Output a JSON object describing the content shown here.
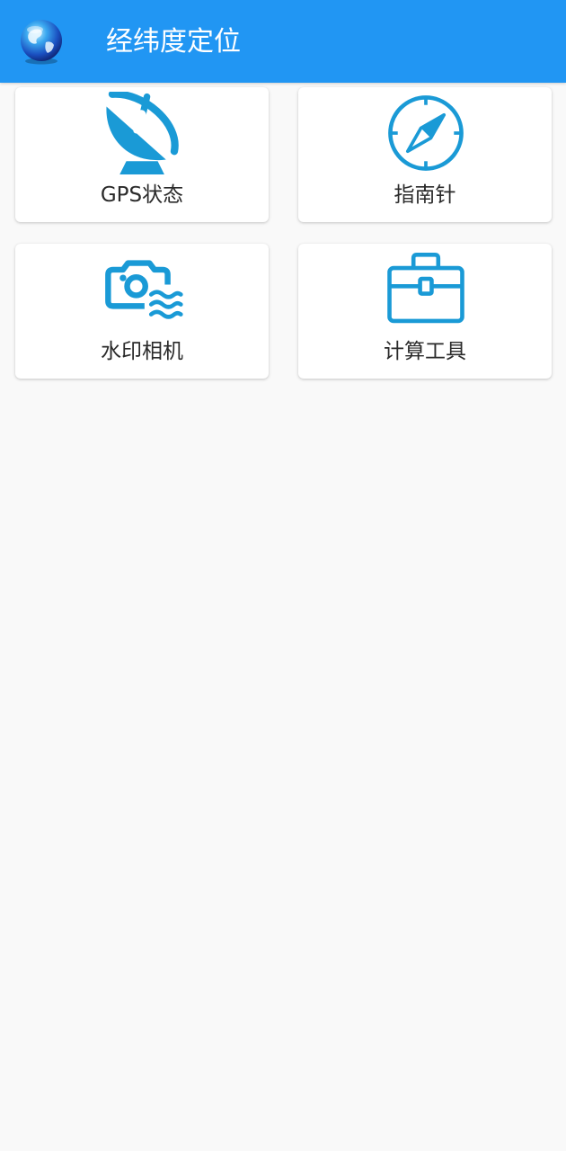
{
  "app": {
    "title": "经纬度定位",
    "logo_icon": "globe-icon",
    "theme_color": "#2196f3",
    "icon_color": "#1a9ad6"
  },
  "tiles": [
    {
      "label": "GPS状态",
      "icon": "satellite-dish-icon"
    },
    {
      "label": "指南针",
      "icon": "compass-icon"
    },
    {
      "label": "水印相机",
      "icon": "watermark-camera-icon"
    },
    {
      "label": "计算工具",
      "icon": "toolbox-icon"
    }
  ]
}
